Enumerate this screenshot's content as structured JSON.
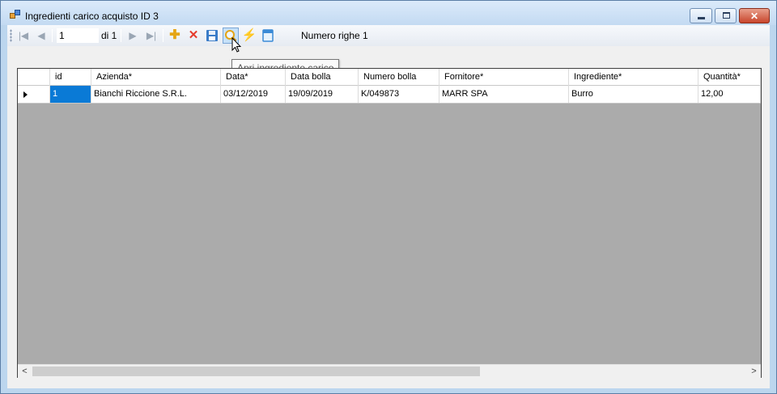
{
  "window": {
    "title": "Ingredienti carico acquisto ID 3",
    "controls": {
      "minimize": "minimize-icon",
      "maximize": "maximize-icon",
      "close": "✕"
    }
  },
  "navigator": {
    "position": "1",
    "of_label": "di 1",
    "row_count_label": "Numero righe 1"
  },
  "tooltip": "Apri ingrediente carico",
  "grid": {
    "columns": [
      "id",
      "Azienda*",
      "Data*",
      "Data bolla",
      "Numero bolla",
      "Fornitore*",
      "Ingrediente*",
      "Quantità*"
    ],
    "rows": [
      [
        "1",
        "Bianchi Riccione S.R.L.",
        "03/12/2019",
        "19/09/2019",
        "K/049873",
        "MARR SPA",
        "Burro",
        "12,00"
      ]
    ]
  },
  "colors": {
    "selected_cell": "#0a7ad6",
    "grid_background": "#ababab",
    "window_frame": "#bcd6ee"
  }
}
